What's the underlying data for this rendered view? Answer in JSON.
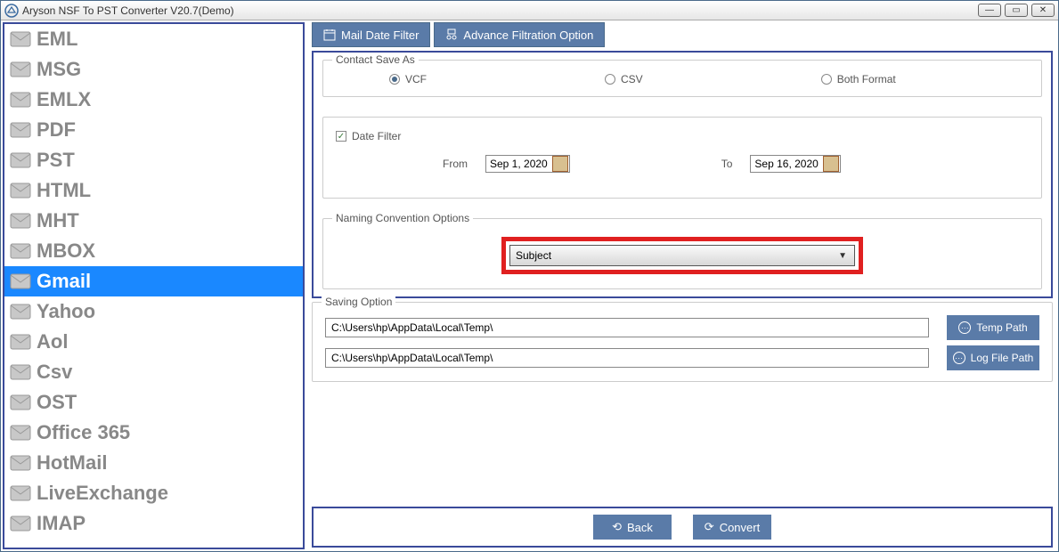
{
  "window": {
    "title": "Aryson NSF To PST Converter V20.7(Demo)"
  },
  "sidebar": {
    "items": [
      {
        "label": "EML",
        "icon": "eml-icon"
      },
      {
        "label": "MSG",
        "icon": "msg-icon"
      },
      {
        "label": "EMLX",
        "icon": "emlx-icon"
      },
      {
        "label": "PDF",
        "icon": "pdf-icon"
      },
      {
        "label": "PST",
        "icon": "pst-icon"
      },
      {
        "label": "HTML",
        "icon": "html-icon"
      },
      {
        "label": "MHT",
        "icon": "mht-icon"
      },
      {
        "label": "MBOX",
        "icon": "mbox-icon"
      },
      {
        "label": "Gmail",
        "icon": "gmail-icon"
      },
      {
        "label": "Yahoo",
        "icon": "yahoo-icon"
      },
      {
        "label": "Aol",
        "icon": "aol-icon"
      },
      {
        "label": "Csv",
        "icon": "csv-icon"
      },
      {
        "label": "OST",
        "icon": "ost-icon"
      },
      {
        "label": "Office 365",
        "icon": "office365-icon"
      },
      {
        "label": "HotMail",
        "icon": "hotmail-icon"
      },
      {
        "label": "LiveExchange",
        "icon": "liveexchange-icon"
      },
      {
        "label": "IMAP",
        "icon": "imap-icon"
      }
    ],
    "selected_index": 8
  },
  "tabs": {
    "items": [
      {
        "label": "Mail Date Filter"
      },
      {
        "label": "Advance Filtration Option"
      }
    ],
    "active_index": 0
  },
  "contact_save": {
    "title": "Contact Save As",
    "options": [
      "VCF",
      "CSV",
      "Both Format"
    ],
    "selected": "VCF"
  },
  "date_filter": {
    "checkbox_label": "Date Filter",
    "checked": true,
    "from_label": "From",
    "to_label": "To",
    "from_value": "Sep 1, 2020",
    "to_value": "Sep 16, 2020"
  },
  "naming": {
    "title": "Naming Convention Options",
    "selected": "Subject"
  },
  "saving": {
    "title": "Saving Option",
    "temp_path": "C:\\Users\\hp\\AppData\\Local\\Temp\\",
    "log_path": "C:\\Users\\hp\\AppData\\Local\\Temp\\",
    "temp_btn": "Temp Path",
    "log_btn": "Log File Path"
  },
  "footer": {
    "back": "Back",
    "convert": "Convert"
  }
}
